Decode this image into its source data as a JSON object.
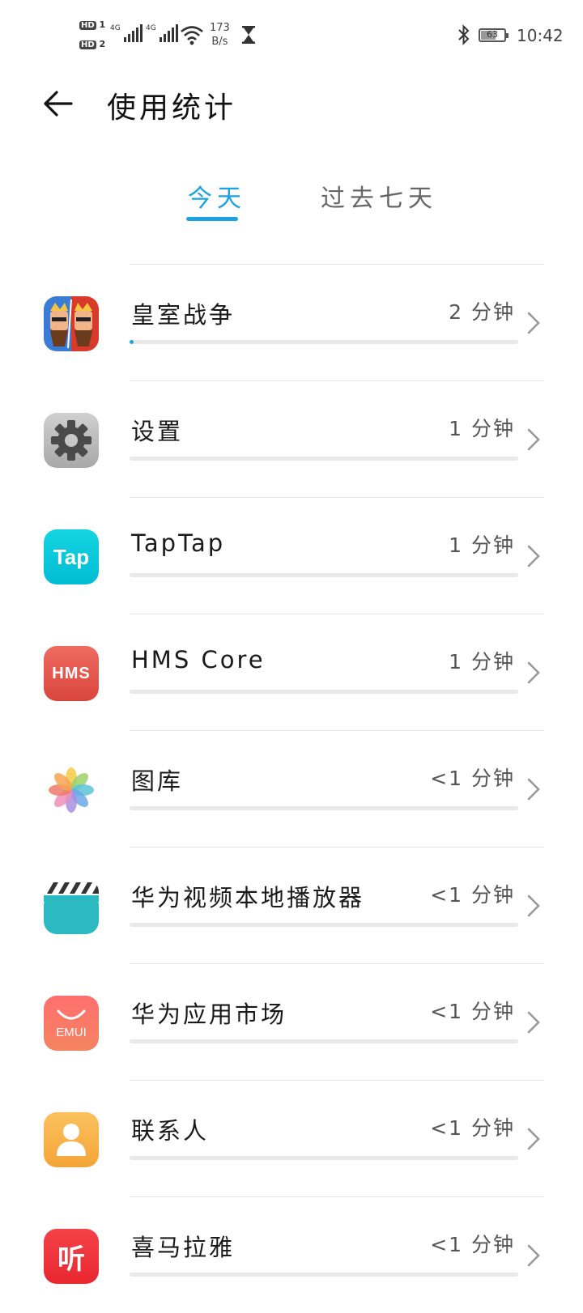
{
  "status_bar": {
    "sim1_label": "HD",
    "sim1_num": "1",
    "sim2_label": "HD",
    "sim2_num": "2",
    "network1": "4G",
    "network2": "4G",
    "speed_value": "173",
    "speed_unit": "B/s",
    "battery": "63",
    "time": "10:42",
    "icons": [
      "signal-icon",
      "wifi-icon",
      "hourglass-icon",
      "bluetooth-icon",
      "battery-icon"
    ]
  },
  "header": {
    "back_icon": "back-arrow-icon",
    "title": "使用统计"
  },
  "tabs": [
    {
      "label": "今天",
      "active": true
    },
    {
      "label": "过去七天",
      "active": false
    }
  ],
  "colors": {
    "accent": "#1aa3e0",
    "track": "#e8e8e8"
  },
  "apps": [
    {
      "name": "皇室战争",
      "duration": "2 分钟",
      "usage_fraction": 0.01,
      "icon": "clash-royale-icon"
    },
    {
      "name": "设置",
      "duration": "1 分钟",
      "usage_fraction": 0,
      "icon": "settings-gear-icon"
    },
    {
      "name": "TapTap",
      "duration": "1 分钟",
      "usage_fraction": 0,
      "icon": "taptap-icon",
      "icon_text": "Tap"
    },
    {
      "name": "HMS Core",
      "duration": "1 分钟",
      "usage_fraction": 0,
      "icon": "hms-core-icon",
      "icon_text": "HMS"
    },
    {
      "name": "图库",
      "duration": "<1 分钟",
      "usage_fraction": 0,
      "icon": "gallery-flower-icon"
    },
    {
      "name": "华为视频本地播放器",
      "duration": "<1 分钟",
      "usage_fraction": 0,
      "icon": "video-clapper-icon"
    },
    {
      "name": "华为应用市场",
      "duration": "<1 分钟",
      "usage_fraction": 0,
      "icon": "appgallery-icon",
      "icon_text": "EMUI"
    },
    {
      "name": "联系人",
      "duration": "<1 分钟",
      "usage_fraction": 0,
      "icon": "contacts-icon"
    },
    {
      "name": "喜马拉雅",
      "duration": "<1 分钟",
      "usage_fraction": 0,
      "icon": "ximalaya-icon",
      "icon_text": "听"
    }
  ]
}
